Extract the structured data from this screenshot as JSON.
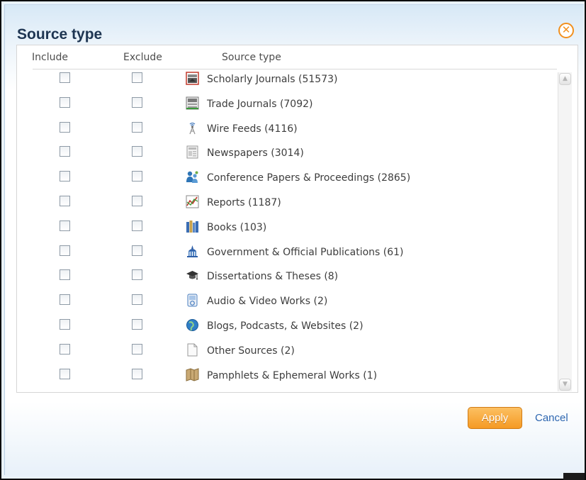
{
  "dialog": {
    "title": "Source type",
    "close_icon": "close-circle-icon",
    "accent_color": "#f2901e"
  },
  "columns": {
    "include": "Include",
    "exclude": "Exclude",
    "source_type": "Source type"
  },
  "items": [
    {
      "label": "Scholarly Journals (51573)",
      "icon": "scholarly-journal-icon",
      "include": false,
      "exclude": false
    },
    {
      "label": "Trade Journals (7092)",
      "icon": "trade-journal-icon",
      "include": false,
      "exclude": false
    },
    {
      "label": "Wire Feeds (4116)",
      "icon": "wire-feed-icon",
      "include": false,
      "exclude": false
    },
    {
      "label": "Newspapers (3014)",
      "icon": "newspaper-icon",
      "include": false,
      "exclude": false
    },
    {
      "label": "Conference Papers & Proceedings (2865)",
      "icon": "conference-icon",
      "include": false,
      "exclude": false
    },
    {
      "label": "Reports (1187)",
      "icon": "report-chart-icon",
      "include": false,
      "exclude": false
    },
    {
      "label": "Books (103)",
      "icon": "books-icon",
      "include": false,
      "exclude": false
    },
    {
      "label": "Government & Official Publications (61)",
      "icon": "government-building-icon",
      "include": false,
      "exclude": false
    },
    {
      "label": "Dissertations & Theses (8)",
      "icon": "graduation-cap-icon",
      "include": false,
      "exclude": false
    },
    {
      "label": "Audio & Video Works (2)",
      "icon": "media-player-icon",
      "include": false,
      "exclude": false
    },
    {
      "label": "Blogs, Podcasts, & Websites (2)",
      "icon": "globe-blog-icon",
      "include": false,
      "exclude": false
    },
    {
      "label": "Other Sources (2)",
      "icon": "blank-document-icon",
      "include": false,
      "exclude": false
    },
    {
      "label": "Pamphlets & Ephemeral Works (1)",
      "icon": "pamphlet-icon",
      "include": false,
      "exclude": false
    }
  ],
  "footer": {
    "apply_label": "Apply",
    "cancel_label": "Cancel"
  }
}
